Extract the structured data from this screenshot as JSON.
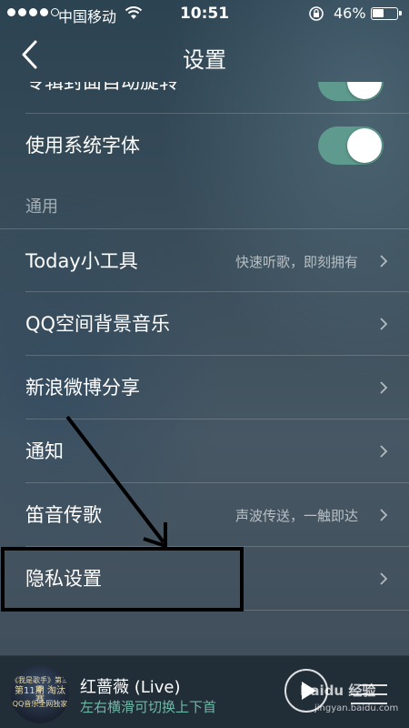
{
  "status_bar": {
    "carrier": "中国移动",
    "time": "10:51",
    "battery": "46%",
    "battery_level": 0.46,
    "signal_bars": 4
  },
  "nav": {
    "title": "设置",
    "back_icon": "chevron-left-icon"
  },
  "rows": {
    "partial_top": {
      "label": "专辑封面自动旋转",
      "toggle_on": true
    },
    "system_font": {
      "label": "使用系统字体",
      "toggle_on": true
    },
    "section_general": "通用",
    "today_widget": {
      "label": "Today小工具",
      "detail": "快速听歌，即刻拥有"
    },
    "qzone_music": {
      "label": "QQ空间背景音乐"
    },
    "weibo_share": {
      "label": "新浪微博分享"
    },
    "notifications": {
      "label": "通知"
    },
    "ultrasonic_share": {
      "label": "笛音传歌",
      "detail": "声波传送，一触即达"
    },
    "privacy": {
      "label": "隐私设置"
    }
  },
  "player": {
    "song": "红蔷薇 (Live)",
    "hint": "左右横滑可切换上下首",
    "cover_text": [
      "《我是歌手》第三季",
      "第11期 淘汰赛",
      "QQ音乐全网独家"
    ]
  },
  "watermark": {
    "brand": "Baidu 经验",
    "url": "jingyan.baidu.com"
  },
  "colors": {
    "toggle_on": "#5e9a8e",
    "hint_text": "#6fb8a6",
    "annotation": "#000000"
  }
}
